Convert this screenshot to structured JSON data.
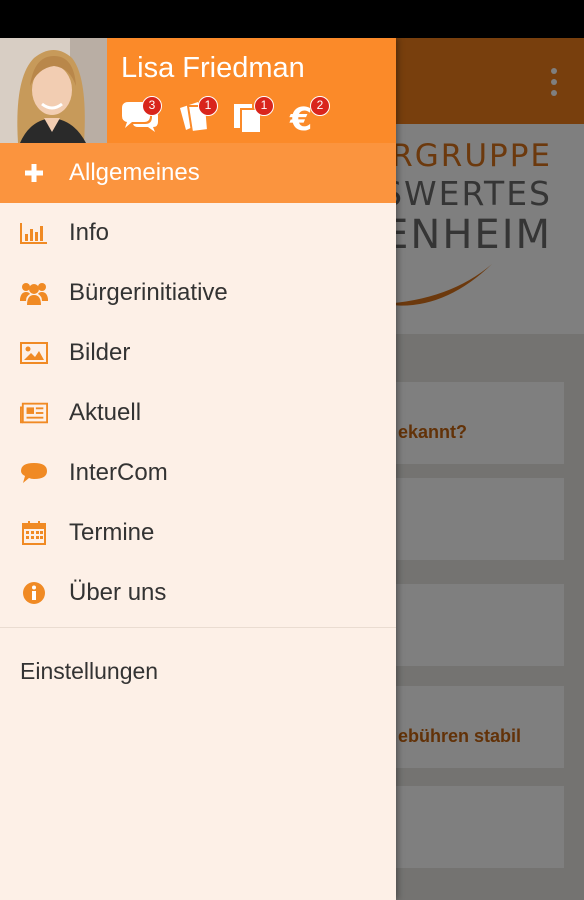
{
  "profile": {
    "name": "Lisa Friedman",
    "badges": {
      "messages": "3",
      "notes": "1",
      "documents": "1",
      "payments": "2"
    }
  },
  "menu": {
    "items": [
      {
        "label": "Allgemeines",
        "icon": "plus-icon",
        "active": true
      },
      {
        "label": "Info",
        "icon": "bar-chart-icon"
      },
      {
        "label": "Bürgerinitiative",
        "icon": "group-icon"
      },
      {
        "label": "Bilder",
        "icon": "image-icon"
      },
      {
        "label": "Aktuell",
        "icon": "newspaper-icon"
      },
      {
        "label": "InterCom",
        "icon": "chat-bubble-icon"
      },
      {
        "label": "Termine",
        "icon": "calendar-icon"
      },
      {
        "label": "Über uns",
        "icon": "info-icon"
      }
    ],
    "settings": "Einstellungen"
  },
  "background": {
    "banner": {
      "line1": "ERGRUPPE",
      "line2": "ISWERTES",
      "line3": "ENHEIM"
    },
    "cards": [
      {
        "text": "ekannt?"
      },
      {
        "text": "ebühren stabil"
      }
    ]
  },
  "colors": {
    "accent": "#fb8a29",
    "active_row": "#fb943e",
    "drawer_bg": "#fdf0e7",
    "badge": "#d9251c",
    "icon": "#f08a24"
  }
}
